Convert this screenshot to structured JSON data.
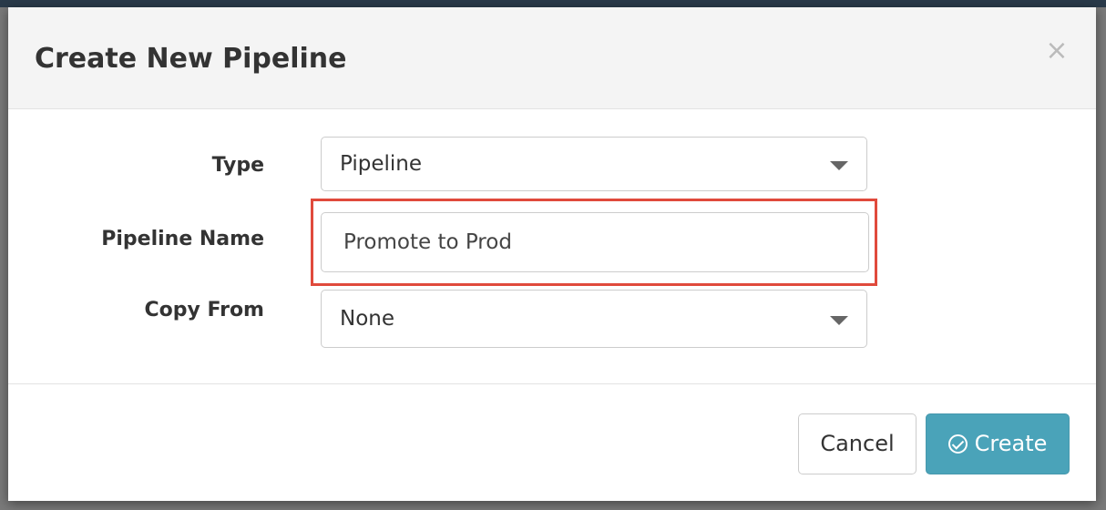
{
  "modal": {
    "title": "Create New Pipeline",
    "close_label": "×"
  },
  "form": {
    "type": {
      "label": "Type",
      "value": "Pipeline"
    },
    "pipeline_name": {
      "label": "Pipeline Name",
      "value": "Promote to Prod"
    },
    "copy_from": {
      "label": "Copy From",
      "value": "None"
    }
  },
  "footer": {
    "cancel_label": "Cancel",
    "create_label": "Create"
  },
  "colors": {
    "highlight": "#e04a3c",
    "primary_button": "#4aa3b9",
    "header_bg": "#f4f4f4"
  },
  "icons": {
    "close": "close-icon",
    "dropdown": "caret-down-icon",
    "create": "check-circle-icon"
  }
}
